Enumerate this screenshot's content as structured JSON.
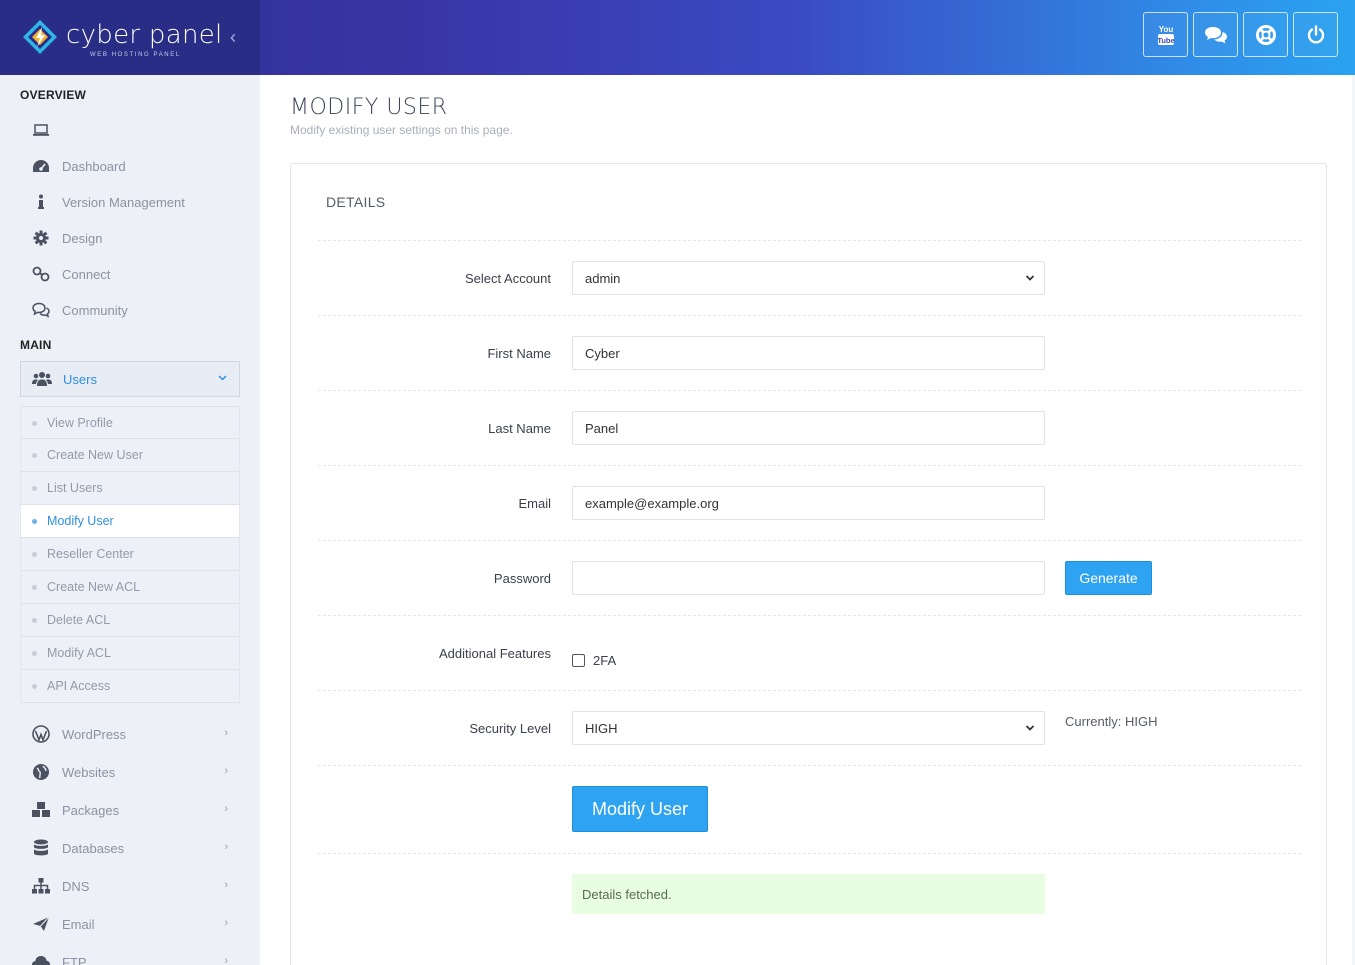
{
  "brand": {
    "name": "cyber panel",
    "tagline": "WEB HOSTING PANEL"
  },
  "topbar": {
    "buttons": [
      {
        "name": "youtube",
        "icon": "youtube-icon"
      },
      {
        "name": "chat",
        "icon": "chat-icon"
      },
      {
        "name": "support",
        "icon": "lifebuoy-icon"
      },
      {
        "name": "logout",
        "icon": "power-icon"
      }
    ]
  },
  "sidebar": {
    "overview_title": "OVERVIEW",
    "overview_items": [
      {
        "label": "",
        "icon": "laptop-icon"
      },
      {
        "label": "Dashboard",
        "icon": "dashboard-icon"
      },
      {
        "label": "Version Management",
        "icon": "info-icon"
      },
      {
        "label": "Design",
        "icon": "gear-icon"
      },
      {
        "label": "Connect",
        "icon": "link-icon"
      },
      {
        "label": "Community",
        "icon": "chat-icon"
      }
    ],
    "main_title": "MAIN",
    "users": {
      "label": "Users",
      "icon": "users-icon"
    },
    "user_sub_items": [
      {
        "label": "View Profile"
      },
      {
        "label": "Create New User"
      },
      {
        "label": "List Users"
      },
      {
        "label": "Modify User",
        "active": true
      },
      {
        "label": "Reseller Center"
      },
      {
        "label": "Create New ACL"
      },
      {
        "label": "Delete ACL"
      },
      {
        "label": "Modify ACL"
      },
      {
        "label": "API Access"
      }
    ],
    "main_items": [
      {
        "label": "WordPress",
        "icon": "wordpress-icon"
      },
      {
        "label": "Websites",
        "icon": "globe-icon"
      },
      {
        "label": "Packages",
        "icon": "cubes-icon"
      },
      {
        "label": "Databases",
        "icon": "database-icon"
      },
      {
        "label": "DNS",
        "icon": "sitemap-icon"
      },
      {
        "label": "Email",
        "icon": "paper-plane-icon"
      },
      {
        "label": "FTP",
        "icon": "cloud-upload-icon"
      }
    ]
  },
  "page": {
    "title": "MODIFY USER",
    "description": "Modify existing user settings on this page."
  },
  "form": {
    "section_title": "DETAILS",
    "select_account": {
      "label": "Select Account",
      "value": "admin"
    },
    "first_name": {
      "label": "First Name",
      "value": "Cyber"
    },
    "last_name": {
      "label": "Last Name",
      "value": "Panel"
    },
    "email": {
      "label": "Email",
      "value": "example@example.org"
    },
    "password": {
      "label": "Password",
      "value": ""
    },
    "generate_label": "Generate",
    "additional_features": {
      "label": "Additional Features",
      "option": "2FA",
      "checked": false
    },
    "security_level": {
      "label": "Security Level",
      "value": "HIGH",
      "current": "Currently: HIGH"
    },
    "submit_label": "Modify User",
    "status_message": "Details fetched."
  },
  "colors": {
    "accent": "#2ea3f2",
    "sidebar_bg": "#edf0f6",
    "success_bg": "#e9fde2"
  }
}
